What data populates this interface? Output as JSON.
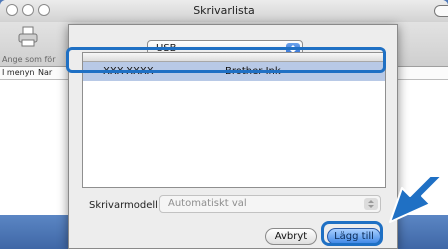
{
  "colors": {
    "accent": "#1f70c4",
    "selection": "#b8c9e6",
    "blue_arrow": "#1f70c4"
  },
  "background_window": {
    "title": "Skrivarlista",
    "toolbar": {
      "add_label": "Ange som för",
      "icon": "printer-icon"
    },
    "columns": [
      "I menyn",
      "Nar"
    ]
  },
  "dialog": {
    "connection_select": {
      "value": "USB"
    },
    "printer_list": {
      "rows": [
        {
          "name": "XXX-XXXX",
          "kind": "Brother Ink",
          "selected": true
        }
      ]
    },
    "model": {
      "label": "Skrivarmodell:",
      "value": "Automatiskt val",
      "disabled": true
    },
    "buttons": {
      "cancel": "Avbryt",
      "add": "Lägg till"
    }
  }
}
